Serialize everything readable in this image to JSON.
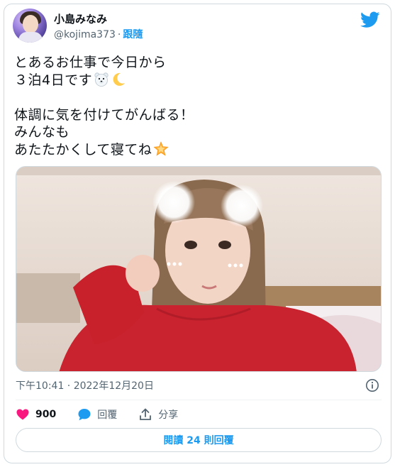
{
  "user": {
    "display_name": "小島みなみ",
    "handle": "@kojima373",
    "separator": "·",
    "follow_label": "跟隨"
  },
  "tweet": {
    "lines": [
      "とあるお仕事で今日から",
      "３泊4日です",
      "",
      "体調に気を付けてがんばる！",
      "みんなも",
      "あたたかくして寝てね"
    ],
    "emojis": [
      "polar-bear-emoji",
      "crescent-moon-emoji",
      "glowing-star-emoji"
    ]
  },
  "photo": {
    "subject": "selfie-photo"
  },
  "timestamp": "下午10:41 · 2022年12月20日",
  "actions": {
    "like_count": "900",
    "reply_label": "回覆",
    "share_label": "分享"
  },
  "read_replies_label": "閱讀 24 則回覆",
  "colors": {
    "accent": "#1d9bf0",
    "like": "#f91880",
    "muted": "#536471",
    "border": "#cfd9de"
  }
}
